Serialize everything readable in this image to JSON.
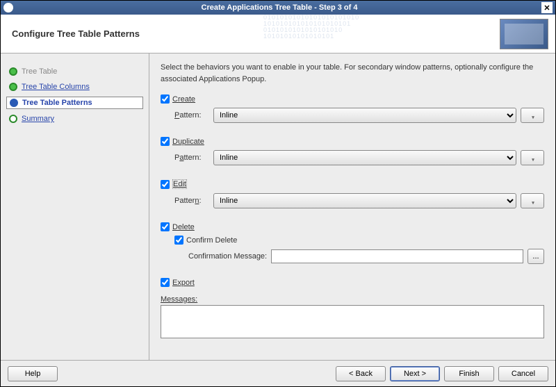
{
  "titlebar": {
    "title": "Create Applications Tree Table - Step 3 of 4"
  },
  "header": {
    "title": "Configure Tree Table Patterns"
  },
  "sidebar": {
    "items": [
      {
        "label": "Tree Table"
      },
      {
        "label": "Tree Table Columns"
      },
      {
        "label": "Tree Table Patterns"
      },
      {
        "label": "Summary"
      }
    ]
  },
  "main": {
    "description": "Select the behaviors you want to enable in your table.  For secondary window patterns, optionally configure the associated Applications Popup.",
    "create": {
      "label": "Create",
      "pattern_label": "Pattern:",
      "value": "Inline"
    },
    "duplicate": {
      "label": "Duplicate",
      "pattern_label": "Pattern:",
      "value": "Inline"
    },
    "edit": {
      "label": "Edit",
      "pattern_label": "Pattern:",
      "value": "Inline"
    },
    "del": {
      "label": "Delete",
      "confirm_label": "Confirm Delete",
      "msg_label": "Confirmation Message:",
      "msg_value": ""
    },
    "export": {
      "label": "Export"
    },
    "messages_label": "Messages:"
  },
  "footer": {
    "help": "Help",
    "back": "< Back",
    "next": "Next >",
    "finish": "Finish",
    "cancel": "Cancel"
  },
  "dropdown_options": [
    "Inline"
  ]
}
